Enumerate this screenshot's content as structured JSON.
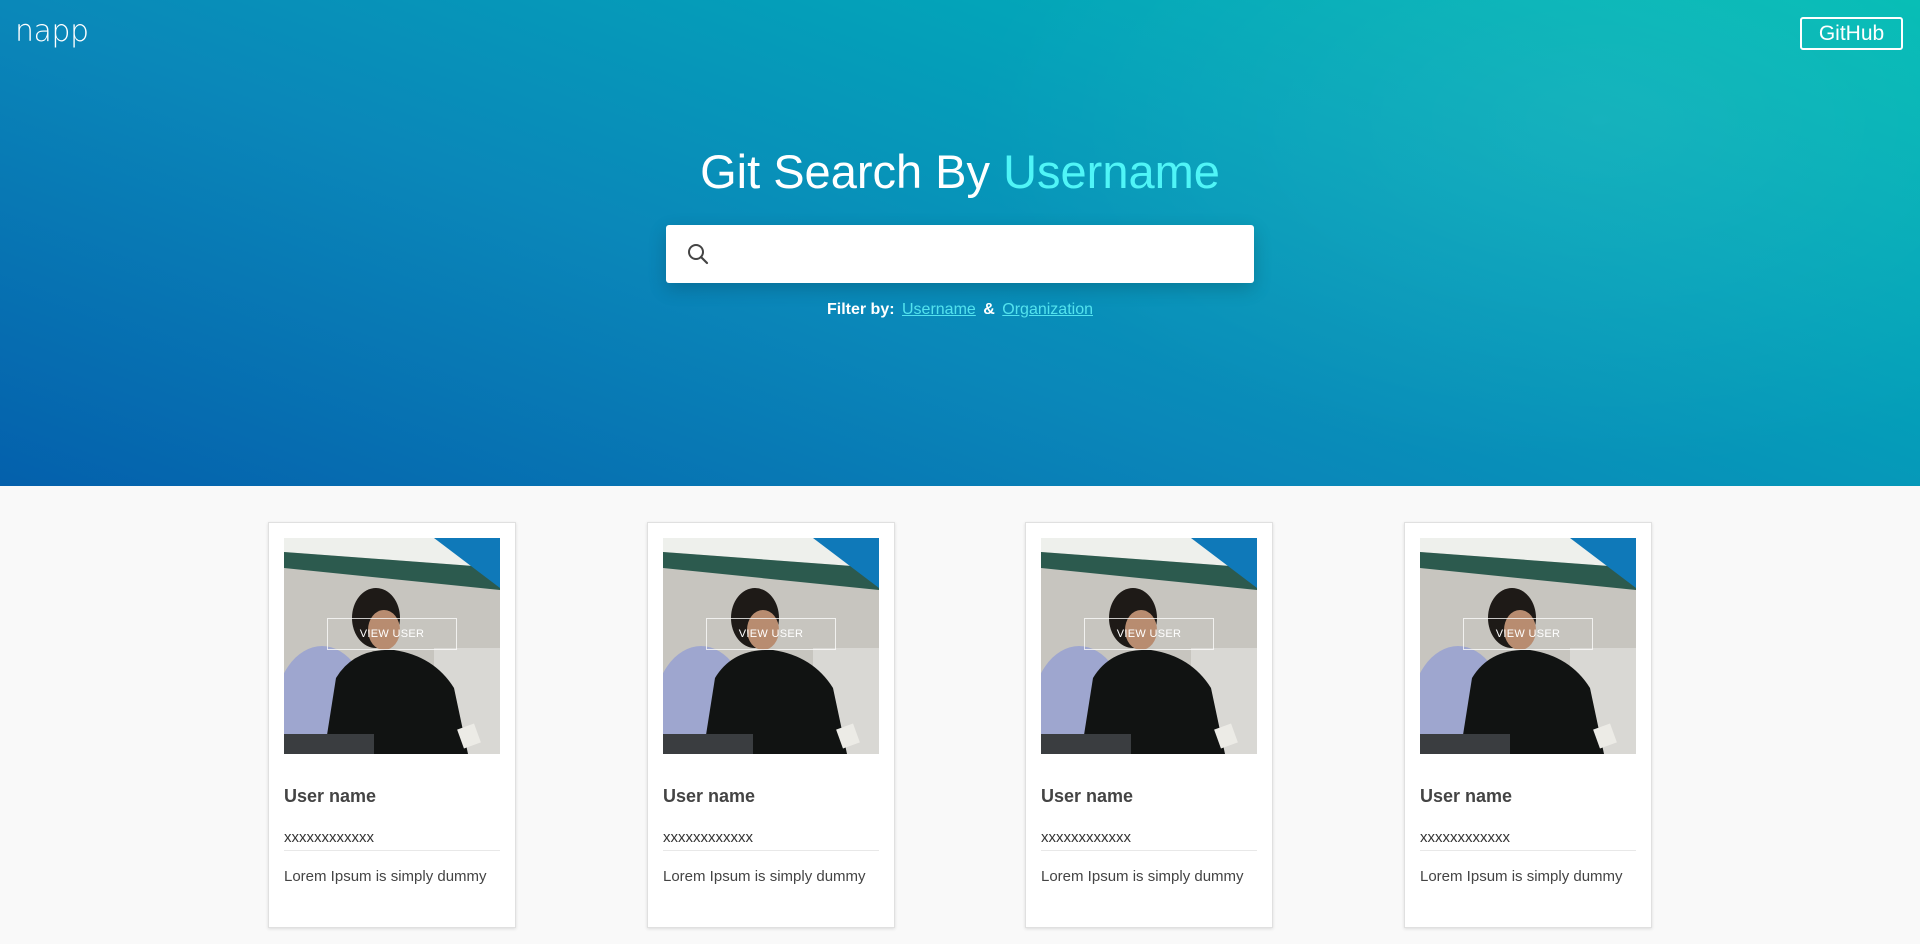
{
  "header": {
    "logo": "napp",
    "github_label": "GitHub"
  },
  "hero": {
    "title_prefix": "Git Search By ",
    "title_accent": "Username",
    "search_placeholder": "",
    "search_value": "",
    "filter_label": "Filter by:",
    "filter_option_1": "Username",
    "filter_separator": "&",
    "filter_option_2": "Organization"
  },
  "cards": [
    {
      "view_label": "VIEW USER",
      "name": "User name",
      "login": "xxxxxxxxxxxx",
      "description": "Lorem Ipsum is simply dummy"
    },
    {
      "view_label": "VIEW USER",
      "name": "User name",
      "login": "xxxxxxxxxxxx",
      "description": "Lorem Ipsum is simply dummy"
    },
    {
      "view_label": "VIEW USER",
      "name": "User name",
      "login": "xxxxxxxxxxxx",
      "description": "Lorem Ipsum is simply dummy"
    },
    {
      "view_label": "VIEW USER",
      "name": "User name",
      "login": "xxxxxxxxxxxx",
      "description": "Lorem Ipsum is simply dummy"
    }
  ],
  "icons": {
    "search": "search-icon",
    "photo": "user-photo"
  },
  "colors": {
    "hero_gradient_start": "#0460ac",
    "hero_gradient_end": "#00bcb4",
    "title_accent": "#4ff5f7",
    "filter_link": "#53e3ee"
  }
}
